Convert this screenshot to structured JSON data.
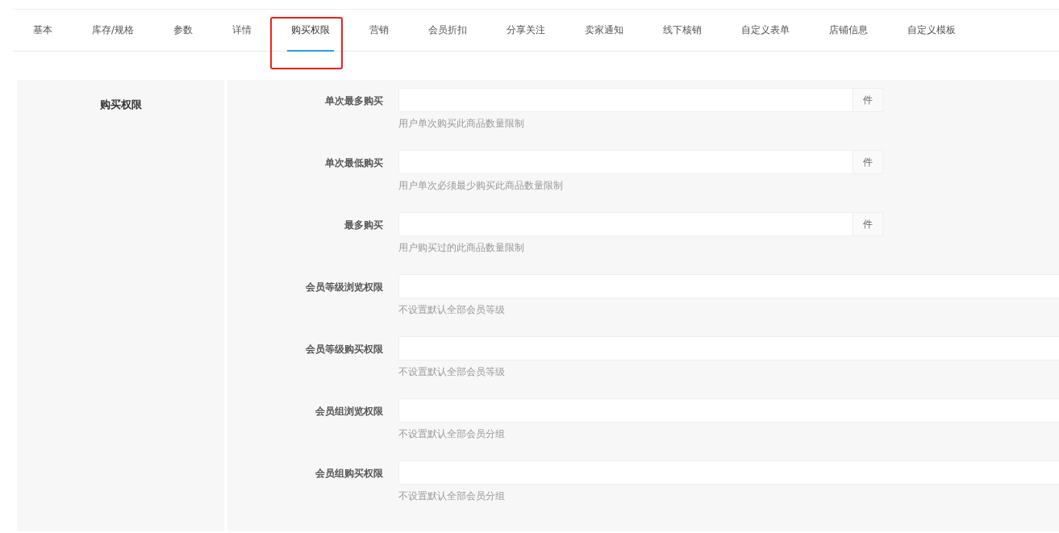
{
  "tabs": [
    {
      "label": "基本",
      "selected": false,
      "highlighted": false
    },
    {
      "label": "库存/规格",
      "selected": false,
      "highlighted": false
    },
    {
      "label": "参数",
      "selected": false,
      "highlighted": false
    },
    {
      "label": "详情",
      "selected": false,
      "highlighted": false
    },
    {
      "label": "购买权限",
      "selected": true,
      "highlighted": true
    },
    {
      "label": "营销",
      "selected": false,
      "highlighted": false
    },
    {
      "label": "会员折扣",
      "selected": false,
      "highlighted": false
    },
    {
      "label": "分享关注",
      "selected": false,
      "highlighted": false
    },
    {
      "label": "卖家通知",
      "selected": false,
      "highlighted": false
    },
    {
      "label": "线下核销",
      "selected": false,
      "highlighted": false
    },
    {
      "label": "自定义表单",
      "selected": false,
      "highlighted": false
    },
    {
      "label": "店铺信息",
      "selected": false,
      "highlighted": false
    },
    {
      "label": "自定义模板",
      "selected": false,
      "highlighted": false
    }
  ],
  "section": {
    "title": "购买权限"
  },
  "fields": [
    {
      "label": "单次最多购买",
      "suffix": "件",
      "help": "用户单次购买此商品数量限制"
    },
    {
      "label": "单次最低购买",
      "suffix": "件",
      "help": "用户单次必须最少购买此商品数量限制"
    },
    {
      "label": "最多购买",
      "suffix": "件",
      "help": "用户购买过的此商品数量限制"
    },
    {
      "label": "会员等级浏览权限",
      "help": "不设置默认全部会员等级"
    },
    {
      "label": "会员等级购买权限",
      "help": "不设置默认全部会员等级"
    },
    {
      "label": "会员组浏览权限",
      "help": "不设置默认全部会员分组"
    },
    {
      "label": "会员组购买权限",
      "help": "不设置默认全部会员分组"
    }
  ]
}
